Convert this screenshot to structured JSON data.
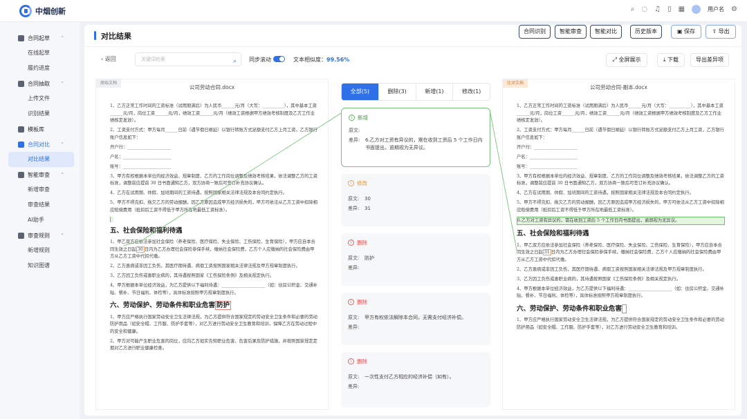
{
  "app": {
    "name": "中烟创新",
    "username": "用户名"
  },
  "sidebar": {
    "groups": [
      {
        "label": "合同起草",
        "items": [
          "在线起草",
          "履约进度"
        ]
      },
      {
        "label": "合同抽取",
        "items": [
          "上传文件",
          "识别结果"
        ]
      },
      {
        "label": "模板库",
        "items": []
      },
      {
        "label": "合同对比",
        "items": [
          "对比结果"
        ]
      },
      {
        "label": "智能审查",
        "items": [
          "新增审查",
          "审查结果",
          "AI助手"
        ]
      },
      {
        "label": "审查规则",
        "items": [
          "新增规则",
          "知识图谱"
        ]
      }
    ]
  },
  "header": {
    "title": "对比结果",
    "buttons": [
      "合同识别",
      "智能审查",
      "智能对比",
      "历史版本",
      "保存",
      "导出"
    ]
  },
  "toolbar": {
    "back": "返回",
    "search_placeholder": "关键词检索",
    "sync_label": "同步滚动",
    "similarity_label": "文本相似度：",
    "similarity_value": "99.56%",
    "fullscreen": "全屏展示",
    "download": "下载",
    "export_diff": "导出差异项"
  },
  "left_doc": {
    "tag": "原始文档",
    "title": "公司劳动合同.docx",
    "p1": "1、乙方正常工作时间的工资标准（试用期满后）为人民币______元/月（大写：__________），其中基本工资______元/月，岗位工资______元/月，绩效工资______元/月（绩效工资根据甲方绩效考核制度及乙方工作业绩核定发放）。",
    "p2": "2、工资支付方式：甲方每月______日前（遇节假日顺延）以银行转账方式足额支付乙方上月工资，乙方银行账户信息如下：",
    "f1": "开户行：____________________",
    "f2": "户名：______________________",
    "f3": "账号：______________________",
    "p3": "3、甲方有权根据本单位的经济效益、规章制度、乙方的工作岗位调整及绩效考核结果，依法调整乙方的工资标准，调整前应提前 30 日书面通知乙方，双方协商一致后可签订补充协议确认。",
    "p4": "4、乙方在试用期、休假、加班期间的工资待遇，按照国家相关法律法规及本合同约定执行。",
    "p5": "5、甲方不得克扣、拖欠乙方的劳动报酬，因乙方原因造成甲方经济损失的，甲方可依法从乙方工资中扣除相应赔偿费用（抵扣后工资不得低于甲方所在地最低工资标准）。",
    "h5": "五、社会保险和福利待遇",
    "s1a": "1、甲乙双方应依法参加社会保险（养老保险、医疗保险、失业保险、工伤保险、生育保险），甲方应自本合同生效之日起",
    "s1mark": "30",
    "s1b": "日内为乙方办理社会保险参保手续，缴纳社会保险费，乙方个人应缴纳的社会保险费由甲方从乙方工资中代扣代缴。",
    "s2": "2、乙方患病或非因工负伤，其医疗期待遇、病假工资按照国家相关法律法规及甲方规章制度执行。",
    "s3": "3、乙方因工负伤或患职业病的，其待遇按照国家《工伤保险条例》及相关规定执行。",
    "s4": "4、甲方根据本单位经济效益，为乙方提供以下福利待遇：____________________（如：住房公积金、交通补贴、餐补、节日福利、体检等），具体标准按照甲方规章制度执行。",
    "h6a": "六、劳动保护、劳动条件和职业危害",
    "h6mark": "防护",
    "t1": "1、甲方应严格执行国家劳动安全卫生法律法规，为乙方提供符合国家规定的劳动安全卫生条件和必要的劳动防护用品（如安全帽、工作服、防护手套等），对乙方进行劳动安全卫生教育和培训，保障乙方在劳动过程中的安全和健康。",
    "t2": "2、甲方对可能产生职业危害的岗位，应向乙方如实告知职业危害、危害后果及防护措施，并按照国家规定定期对乙方进行职业健康检查。"
  },
  "right_doc": {
    "tag": "比对文档",
    "title": "公司劳动合同-副本.docx",
    "p1": "1、乙方正常工作时间的工资标准（试用期满后）为人民币______元/月（大写：__________），其中基本工资______元/月，岗位工资______元/月，绩效工资______元/月（绩效工资根据甲方绩效考核制度及乙方工作业绩核定发放）。",
    "p2": "2、工资支付方式：甲方每月______日前（遇节假日顺延）以银行转账方式足额支付乙方上月工资，乙方银行账户信息如下：",
    "f1": "开户行：____________________",
    "f2": "户名：______________________",
    "f3": "账号：______________________",
    "p3": "3、甲方有权根据本单位的经济效益、规章制度、乙方的工作岗位调整及绩效考核结果，依法调整乙方的工资标准，调整前应提前 30 日书面通知乙方，双方协商一致后可签订补充协议确认。",
    "p4": "4、乙方在试用期、休假、加班期间的工资待遇，按照国家相关法律法规及本合同约定执行。",
    "p5": "5、甲方不得克扣、拖欠乙方的劳动报酬，因乙方原因造成甲方经济损失的，甲方可依法从乙方工资中扣除相应赔偿费用（抵扣后工资不得低于甲方所在地最低工资标准）。",
    "p6": "6.乙方对工资有异议的，需在收到工资后 5 个工作日内书面提出，逾期视为无异议。",
    "h5": "五、社会保险和福利待遇",
    "s1a": "1、甲乙双方应依法参加社会保险（养老保险、医疗保险、失业保险、工伤保险、生育保险），甲方应自本合同生效之日起",
    "s1mark": "31",
    "s1b": "日内为乙方办理社会保险参保手续，缴纳社会保险费，乙方个人应缴纳的社会保险费由甲方从乙方工资中代扣代缴。",
    "s2": "2、乙方患病或非因工负伤，其医疗期待遇、病假工资按照国家相关法律法规及甲方规章制度执行。",
    "s3": "3、乙方因工负伤或患职业病的，其待遇按照国家《工伤保险条例》及相关规定执行。",
    "s4": "4、甲方根据本单位经济效益，为乙方提供以下福利待遇：____________________（如：住房公积金、交通补贴、餐补、节日福利、体检等），具体标准按照甲方规章制度执行。",
    "h6": "六、劳动保护、劳动条件和职业危害",
    "t1": "1、甲方应严格执行国家劳动安全卫生法律法规，为乙方提供符合国家规定的劳动安全卫生条件和必要的劳动防护用品（如安全帽、工作服、防护手套等），对乙方进行劳动安全卫生教育和培训。"
  },
  "diff_panel": {
    "tabs": [
      "全部(5)",
      "删除(3)",
      "新增(1)",
      "修改(1)"
    ],
    "original_label": "原文:",
    "diff_label": "差异:",
    "cards": [
      {
        "type": "新增",
        "original": "",
        "diff": "6.乙方对工资有异议的，需在收到工资后 5 个工作日内书面提出，逾期视为无异议。"
      },
      {
        "type": "修改",
        "original": "30",
        "diff": "31"
      },
      {
        "type": "删除",
        "original": "防护",
        "diff": ""
      },
      {
        "type": "删除",
        "original": "甲方有权依法解除本合同，无需支付经济补偿。",
        "diff": ""
      },
      {
        "type": "删除",
        "original": "一次性支付乙方相应的经济补偿（如有）。",
        "diff": ""
      }
    ]
  },
  "colors": {
    "accent": "#2f6fe8",
    "added": "#5cb85c",
    "modified": "#f0a04b",
    "deleted": "#ef5b5b"
  }
}
